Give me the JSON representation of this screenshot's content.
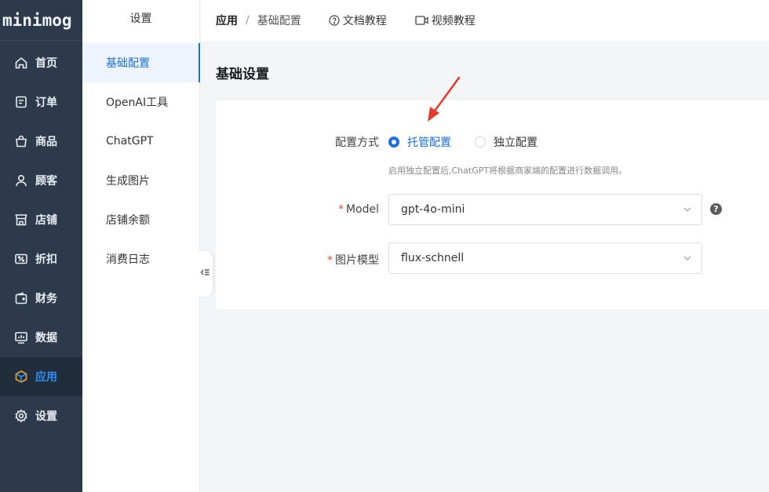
{
  "app": {
    "logo": "minimog"
  },
  "nav": {
    "items": [
      {
        "label": "首页",
        "icon": "home-icon"
      },
      {
        "label": "订单",
        "icon": "order-icon"
      },
      {
        "label": "商品",
        "icon": "bag-icon"
      },
      {
        "label": "顾客",
        "icon": "user-icon"
      },
      {
        "label": "店铺",
        "icon": "store-icon"
      },
      {
        "label": "折扣",
        "icon": "discount-icon"
      },
      {
        "label": "财务",
        "icon": "wallet-icon"
      },
      {
        "label": "数据",
        "icon": "chart-icon"
      },
      {
        "label": "应用",
        "icon": "box-icon",
        "active": true
      },
      {
        "label": "设置",
        "icon": "gear-icon"
      }
    ],
    "active_color": "#2f8ef9"
  },
  "submenu": {
    "title": "设置",
    "items": [
      {
        "label": "基础配置",
        "active": true
      },
      {
        "label": "OpenAI工具"
      },
      {
        "label": "ChatGPT"
      },
      {
        "label": "生成图片"
      },
      {
        "label": "店铺余额"
      },
      {
        "label": "消费日志"
      }
    ]
  },
  "topbar": {
    "breadcrumb_current": "应用",
    "breadcrumb_separator": "/",
    "breadcrumb_page": "基础配置",
    "doc_link": "文档教程",
    "video_link": "视频教程"
  },
  "main": {
    "title": "基础设置",
    "config_mode": {
      "label": "配置方式",
      "options": [
        {
          "label": "托管配置",
          "selected": true
        },
        {
          "label": "独立配置",
          "selected": false
        }
      ],
      "hint": "启用独立配置后,ChatGPT将根据商家端的配置进行数据调用。"
    },
    "model": {
      "required_mark": "*",
      "label": "Model",
      "value": "gpt-4o-mini",
      "help": "?"
    },
    "image_model": {
      "required_mark": "*",
      "label": "图片模型",
      "value": "flux-schnell"
    }
  },
  "colors": {
    "primary": "#1a6fe8",
    "sidebar_bg": "#2d3a4b",
    "required": "#e8543e",
    "annotation_arrow": "#e53a2c"
  }
}
